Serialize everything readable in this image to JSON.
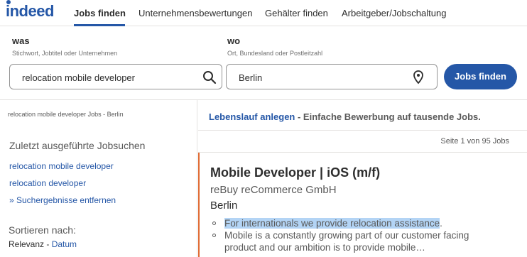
{
  "brand": {
    "logo_text": "indeed",
    "accent_color": "#2557a7"
  },
  "nav": {
    "items": [
      {
        "label": "Jobs finden",
        "active": true
      },
      {
        "label": "Unternehmensbewertungen",
        "active": false
      },
      {
        "label": "Gehälter finden",
        "active": false
      },
      {
        "label": "Arbeitgeber/Jobschaltung",
        "active": false
      }
    ]
  },
  "search": {
    "what": {
      "label": "was",
      "hint": "Stichwort, Jobtitel oder Unternehmen",
      "value": "relocation mobile developer",
      "icon": "search-icon"
    },
    "where": {
      "label": "wo",
      "hint": "Ort, Bundesland oder Postleitzahl",
      "value": "Berlin",
      "icon": "location-pin-icon"
    },
    "button_label": "Jobs finden"
  },
  "sidebar": {
    "breadcrumb": "relocation mobile developer Jobs - Berlin",
    "recent_title": "Zuletzt ausgeführte Jobsuchen",
    "recent_searches": [
      "relocation mobile developer",
      "relocation developer"
    ],
    "remove_label": "» Suchergebnisse entfernen",
    "sort_title": "Sortieren nach:",
    "sort_current": "Relevanz",
    "sort_separator": " - ",
    "sort_other": "Datum"
  },
  "results": {
    "promo_link": "Lebenslauf anlegen",
    "promo_text": " - Einfache Bewerbung auf tausende Jobs.",
    "page_count": "Seite 1 von 95 Jobs",
    "jobs": [
      {
        "title": "Mobile Developer | iOS (m/f)",
        "company": "reBuy reCommerce GmbH",
        "location": "Berlin",
        "snippet_highlight": "For internationals we provide relocation assistance",
        "snippet_highlight_tail": ".",
        "snippet_line2": "Mobile is a constantly growing part of our customer facing",
        "snippet_line3": "product and our ambition is to provide mobile…",
        "accent_color": "#e06b34"
      }
    ]
  }
}
